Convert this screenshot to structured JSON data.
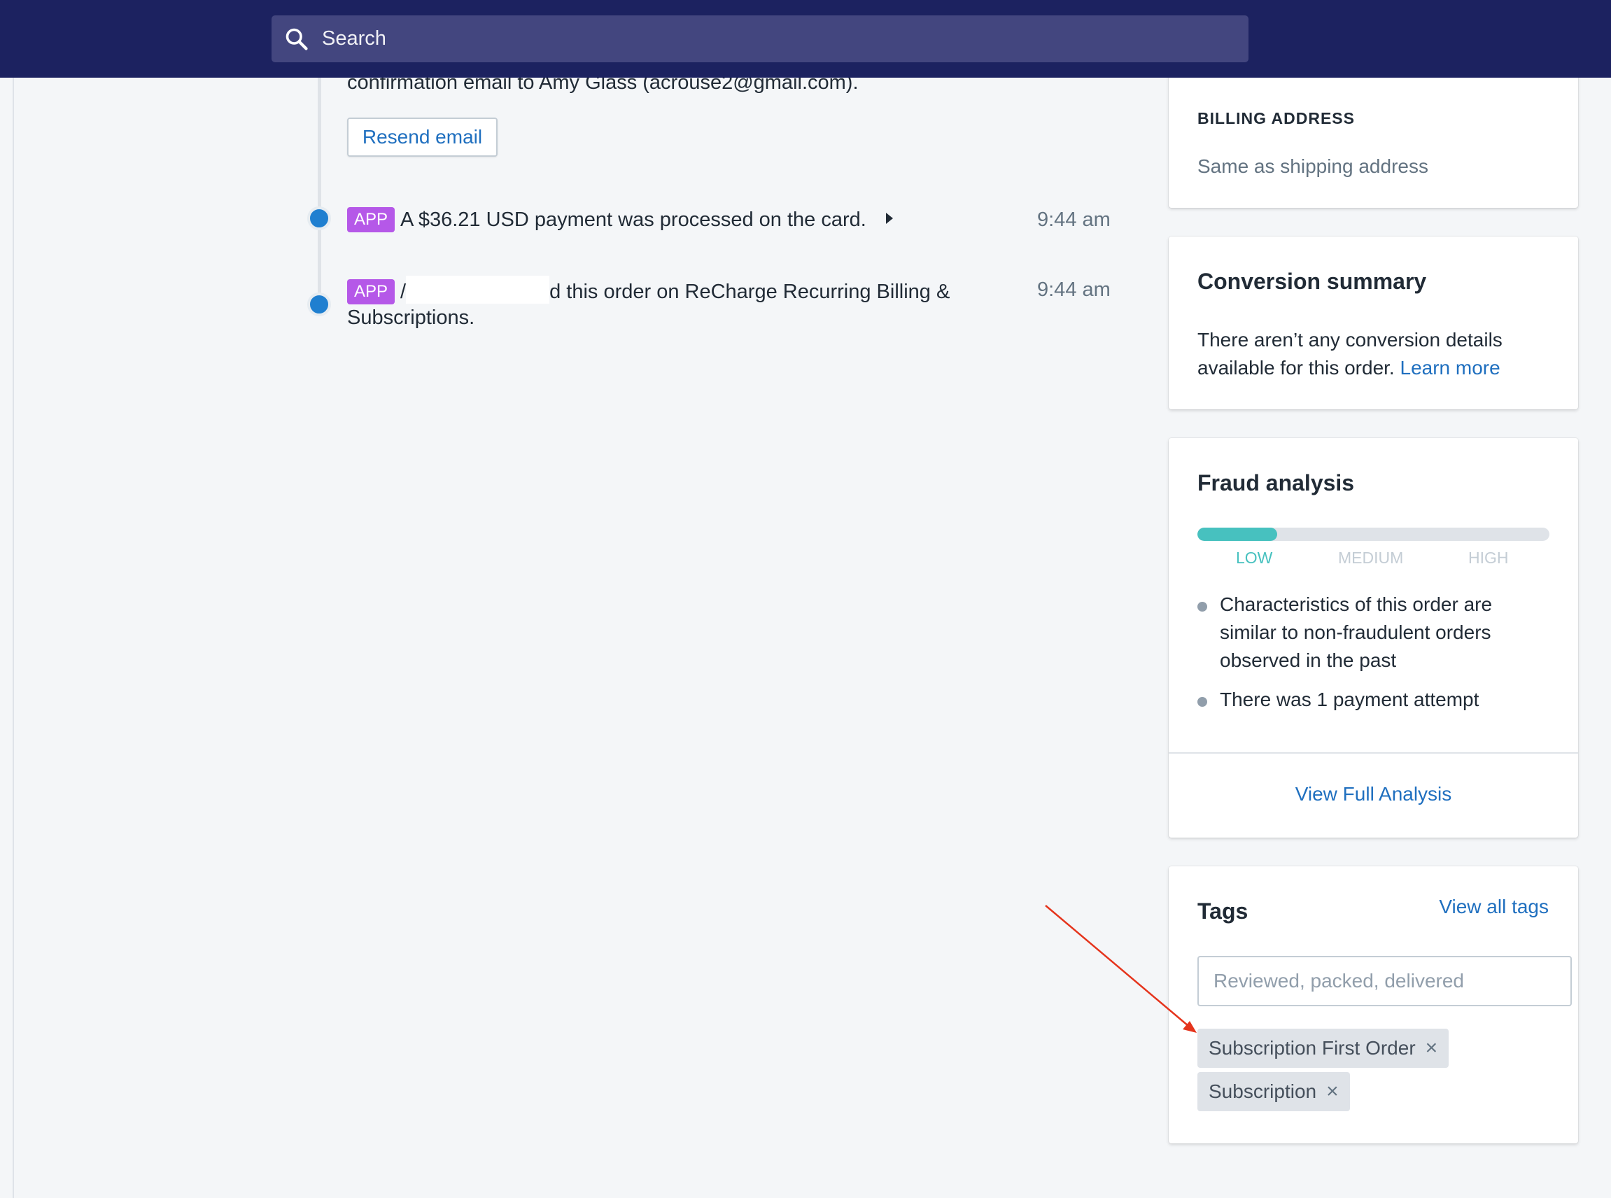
{
  "search": {
    "placeholder": "Search"
  },
  "timeline": {
    "email_line": "confirmation email to Amy Glass (acrouse2@gmail.com).",
    "resend_label": "Resend email",
    "events": [
      {
        "badge": "APP",
        "text": "A $36.21 USD payment was processed on the card.",
        "time": "9:44 am"
      },
      {
        "badge": "APP",
        "text_before": "/",
        "text_after": "d this order on ReCharge Recurring Billing &",
        "text_line2": "Subscriptions.",
        "time": "9:44 am"
      }
    ]
  },
  "billing": {
    "title": "BILLING ADDRESS",
    "value": "Same as shipping address"
  },
  "conversion": {
    "title": "Conversion summary",
    "line1": "There aren’t any conversion details",
    "line2": "available for this order.",
    "link": "Learn more"
  },
  "fraud": {
    "title": "Fraud analysis",
    "risk_level": "low",
    "levels": [
      "LOW",
      "MEDIUM",
      "HIGH"
    ],
    "bullets": [
      [
        "Characteristics of this order are",
        "similar to non-fraudulent orders",
        "observed in the past"
      ],
      [
        "There was 1 payment attempt"
      ]
    ],
    "action": "View Full Analysis",
    "colors": {
      "low": "#47c1bf",
      "inactive": "#c4cdd5"
    }
  },
  "tags": {
    "title": "Tags",
    "view_all": "View all tags",
    "input_placeholder": "Reviewed, packed, delivered",
    "items": [
      "Subscription First Order",
      "Subscription"
    ]
  }
}
